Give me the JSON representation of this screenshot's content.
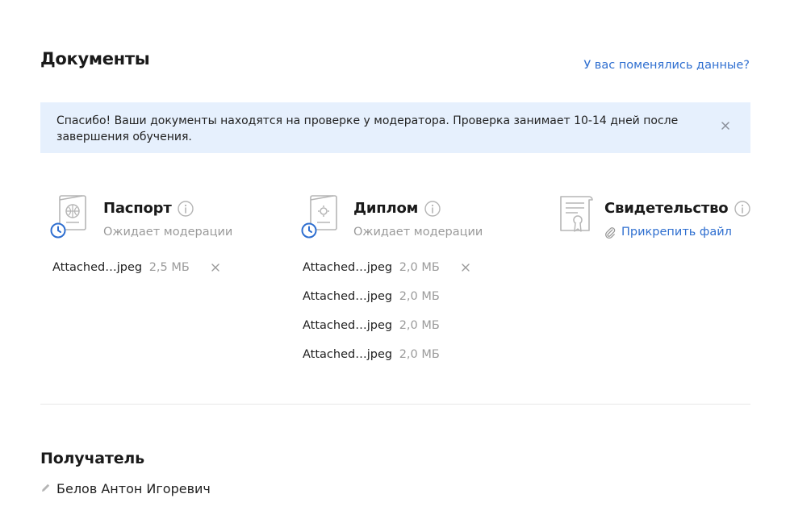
{
  "documents": {
    "title": "Документы",
    "changed_link": "У вас поменялись данные?"
  },
  "notice": {
    "text": "Спасибо! Ваши документы находятся на проверке у модератора. Проверка занимает 10-14 дней после завершения обучения."
  },
  "cards": {
    "passport": {
      "title": "Паспорт",
      "status": "Ожидает модерации",
      "files": [
        {
          "name": "Attached…jpeg",
          "size": "2,5 МБ"
        }
      ]
    },
    "diploma": {
      "title": "Диплом",
      "status": "Ожидает модерации",
      "files": [
        {
          "name": "Attached…jpeg",
          "size": "2,0 МБ"
        },
        {
          "name": "Attached…jpeg",
          "size": "2,0 МБ"
        },
        {
          "name": "Attached…jpeg",
          "size": "2,0 МБ"
        },
        {
          "name": "Attached…jpeg",
          "size": "2,0 МБ"
        }
      ]
    },
    "certificate": {
      "title": "Свидетельство",
      "attach_label": "Прикрепить файл"
    }
  },
  "recipient": {
    "title": "Получатель",
    "name": "Белов Антон Игоревич"
  },
  "colors": {
    "accent": "#2f6fd0",
    "notice_bg": "#e6f0fd",
    "muted_text": "#9a9a9a",
    "icon_gray": "#b5b5b5",
    "clock_blue": "#2f6fd0"
  },
  "icons": {
    "passport": "passport-document-icon",
    "diploma": "diploma-document-icon",
    "certificate": "certificate-document-icon",
    "pending": "clock-icon",
    "info": "info-icon",
    "close": "close-icon",
    "attach": "paperclip-icon",
    "edit": "pencil-icon"
  }
}
